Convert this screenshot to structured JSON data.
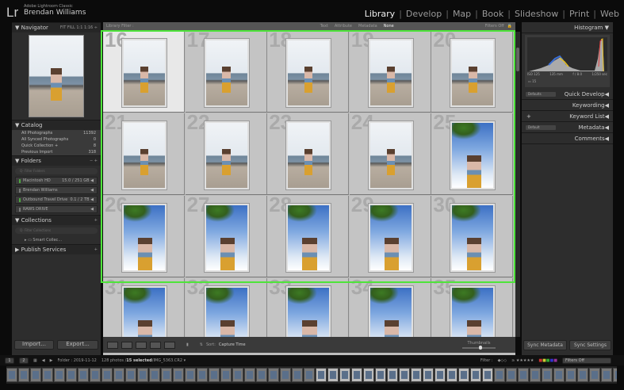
{
  "app": {
    "logo": "Lr",
    "product": "Adobe Lightroom Classic",
    "user": "Brendan Williams"
  },
  "modules": [
    "Library",
    "Develop",
    "Map",
    "Book",
    "Slideshow",
    "Print",
    "Web"
  ],
  "active_module": "Library",
  "navigator": {
    "title": "Navigator",
    "zoom": "FIT  FILL  1:1  1:16 ÷"
  },
  "catalog": {
    "title": "Catalog",
    "items": [
      {
        "label": "All Photographs",
        "count": "11392"
      },
      {
        "label": "All Synced Photographs",
        "count": "0"
      },
      {
        "label": "Quick Collection +",
        "count": "8"
      },
      {
        "label": "Previous Import",
        "count": "318"
      }
    ]
  },
  "folders": {
    "title": "Folders",
    "actions": "−  +",
    "filter_placeholder": "Q- Filter Folders",
    "drives": [
      {
        "name": "Macintosh HD",
        "info": "15.0 / 251 GB",
        "led": "#4ea640"
      },
      {
        "name": "Brendan Williams",
        "info": "",
        "led": "#777"
      },
      {
        "name": "Outbound Travel Drive",
        "info": "0.1 / 2 TB",
        "led": "#4ea640"
      },
      {
        "name": "RAWS DRIVE",
        "info": "",
        "led": "#777"
      }
    ]
  },
  "collections": {
    "title": "Collections",
    "filter_placeholder": "Q- Filter Collections",
    "item": "Smart Collec..."
  },
  "publish": {
    "title": "Publish Services"
  },
  "left_buttons": {
    "import": "Import...",
    "export": "Export..."
  },
  "library_filter": {
    "label": "Library Filter :",
    "tabs": [
      "Text",
      "Attribute",
      "Metadata",
      "None"
    ],
    "active": "None",
    "status": "Filters Off"
  },
  "grid": {
    "cells": [
      {
        "n": "16",
        "t": "beach",
        "sel": true
      },
      {
        "n": "17",
        "t": "beach"
      },
      {
        "n": "18",
        "t": "beach"
      },
      {
        "n": "19",
        "t": "beach"
      },
      {
        "n": "20",
        "t": "beach"
      },
      {
        "n": "21",
        "t": "beach"
      },
      {
        "n": "22",
        "t": "beach"
      },
      {
        "n": "23",
        "t": "beach"
      },
      {
        "n": "24",
        "t": "beach"
      },
      {
        "n": "25",
        "t": "palm"
      },
      {
        "n": "26",
        "t": "palm"
      },
      {
        "n": "27",
        "t": "palm"
      },
      {
        "n": "28",
        "t": "palm"
      },
      {
        "n": "29",
        "t": "palm"
      },
      {
        "n": "30",
        "t": "palm"
      },
      {
        "n": "31",
        "t": "palm"
      },
      {
        "n": "32",
        "t": "palm"
      },
      {
        "n": "33",
        "t": "palm"
      },
      {
        "n": "34",
        "t": "palm"
      },
      {
        "n": "35",
        "t": "palm"
      }
    ]
  },
  "toolbar": {
    "sort_label": "Sort:",
    "sort_value": "Capture Time",
    "thumbnails_label": "Thumbnails",
    "thumbnail_size": 0.55
  },
  "histogram": {
    "title": "Histogram",
    "iso": "ISO 125",
    "focal": "135 mm",
    "aperture": "f / 8.0",
    "shutter": "1/250 sec",
    "count": "15"
  },
  "right_panels": [
    {
      "title": "Quick Develop",
      "dropdown": "Defaults"
    },
    {
      "title": "Keywording"
    },
    {
      "title": "Keyword List",
      "prefix": "+"
    },
    {
      "title": "Metadata",
      "dropdown": "Default"
    },
    {
      "title": "Comments"
    }
  ],
  "right_buttons": {
    "sync_metadata": "Sync Metadata",
    "sync_settings": "Sync Settings"
  },
  "filmstrip": {
    "screens": [
      "1",
      "2"
    ],
    "folder": "Folder : 2019-11-12",
    "count": "128 photos /",
    "selected": "15 selected",
    "file": "/IMG_5363.CR2 ▾",
    "filter_label": "Filter :",
    "rating": "≥ ★★★★★",
    "filter_value": "Filters Off"
  },
  "colors": {
    "selection": "#4ee43a",
    "panel": "#2d2d2d",
    "grid_bg": "#c4c4c4"
  }
}
